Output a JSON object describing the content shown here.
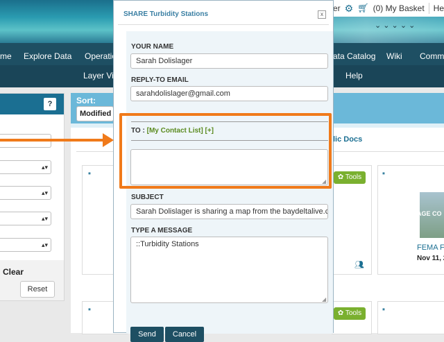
{
  "header": {
    "top_links": {
      "user_fragment": "ger",
      "basket": "(0) My Basket",
      "help_fragment": "He"
    },
    "nav_primary": [
      "me",
      "Explore Data",
      "Operatio",
      "ata Catalog",
      "Wiki",
      "Commu"
    ],
    "nav_secondary": [
      "Layer Vie",
      "Help"
    ]
  },
  "left_panel": {
    "help_button": "?",
    "clear_label": "Clear",
    "reset_label": "Reset"
  },
  "sort": {
    "label": "Sort:",
    "selected": "Modified"
  },
  "content": {
    "public_docs": "lic Docs",
    "tools_label": "Tools",
    "card_caption_fragment": "AGE CO",
    "card_title_fragment": "FEMA FI",
    "card_date_fragment": "Nov 11, 20"
  },
  "modal": {
    "title": "SHARE Turbidity Stations",
    "close": "x",
    "your_name_label": "YOUR NAME",
    "your_name_value": "Sarah Dolislager",
    "reply_to_label": "REPLY-TO EMAIL",
    "reply_to_value": "sarahdolislager@gmail.com",
    "to_label": "TO :",
    "to_contact_list": "[My Contact List]",
    "to_add": "[+]",
    "to_value": "",
    "subject_label": "SUBJECT",
    "subject_value": "Sarah Dolislager is sharing a map from the baydeltalive.com",
    "message_label": "TYPE A MESSAGE",
    "message_value": "::Turbidity Stations",
    "send_label": "Send",
    "cancel_label": "Cancel"
  },
  "colors": {
    "accent_orange": "#f07a1a",
    "nav_dark": "#1e4f63",
    "tools_green": "#7ab02f",
    "link_green": "#5a8a1e"
  }
}
